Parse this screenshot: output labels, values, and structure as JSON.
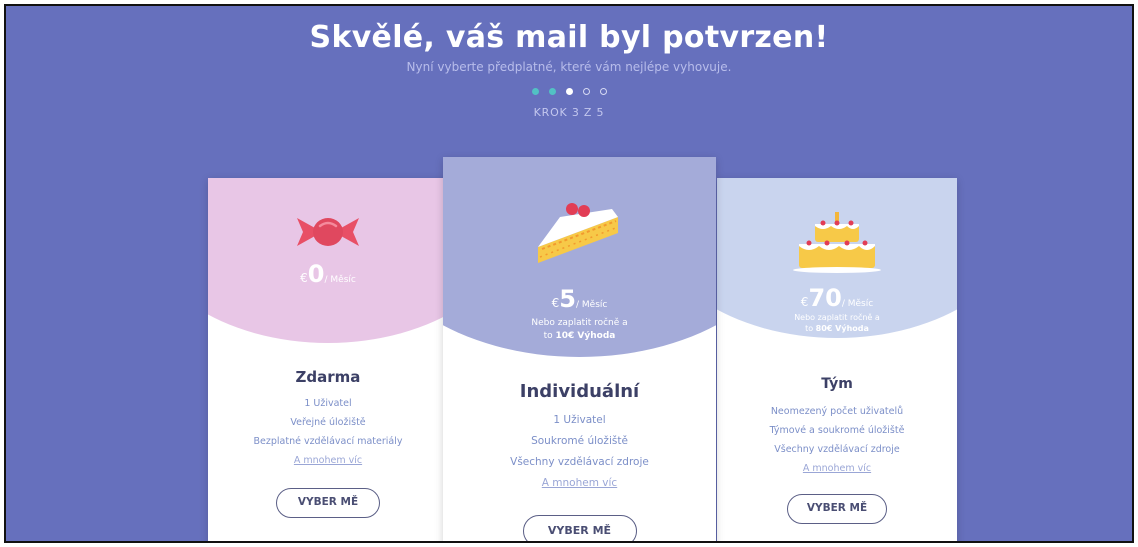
{
  "header": {
    "title": "Skvělé, váš mail byl potvrzen!",
    "subtitle": "Nyní vyberte předplatné, které vám nejlépe vyhovuje.",
    "step_label": "KROK 3 Z 5",
    "current_step": 3,
    "total_steps": 5
  },
  "plans": [
    {
      "name": "Zdarma",
      "icon": "candy-icon",
      "currency": "€",
      "price": "0",
      "period": "/ Měsíc",
      "features": [
        "1 Uživatel",
        "Veřejné úložiště",
        "Bezplatné vzdělávací materiály"
      ],
      "more_link": "A mnohem víc",
      "button": "VYBER MĚ"
    },
    {
      "name": "Individuální",
      "icon": "cake-slice-icon",
      "currency": "€",
      "price": "5",
      "period": "/ Měsíc",
      "note_line1": "Nebo zaplatit ročně a",
      "note_line2_prefix": "to ",
      "note_highlight": "10€ Výhoda",
      "features": [
        "1 Uživatel",
        "Soukromé úložiště",
        "Všechny vzdělávací zdroje"
      ],
      "more_link": "A mnohem víc",
      "button": "VYBER MĚ"
    },
    {
      "name": "Tým",
      "icon": "birthday-cake-icon",
      "currency": "€",
      "price": "70",
      "period": "/ Měsíc",
      "note_line1": "Nebo zaplatit ročně a",
      "note_line2_prefix": "to ",
      "note_highlight": "80€ Výhoda",
      "features": [
        "Neomezený počet uživatelů",
        "Týmové a soukromé úložiště",
        "Všechny vzdělávací zdroje"
      ],
      "more_link": "A mnohem víc",
      "button": "VYBER MĚ"
    }
  ],
  "colors": {
    "background": "#6670bd",
    "free_header": "#e8c6e6",
    "individual_header": "#a4abd9",
    "team_header": "#c9d4ee",
    "step_done": "#52c1c4",
    "link": "#9aa6d6"
  }
}
